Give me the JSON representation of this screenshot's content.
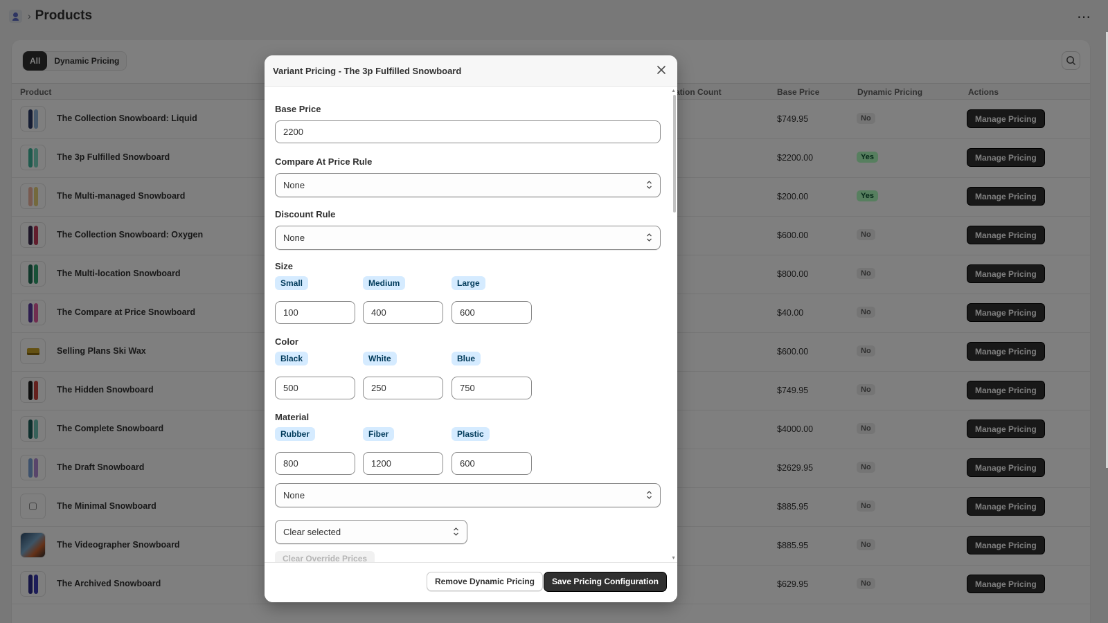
{
  "header": {
    "title": "Products",
    "more_label": "⋯"
  },
  "tabs": [
    {
      "label": "All"
    },
    {
      "label": "Dynamic Pricing"
    }
  ],
  "columns": {
    "product": "Product",
    "count": "ation Count",
    "base_price": "Base Price",
    "dynamic": "Dynamic Pricing",
    "actions": "Actions"
  },
  "rows": [
    {
      "name": "The Collection Snowboard: Liquid",
      "price": "$749.95",
      "dynamic": "No",
      "action": "Manage Pricing"
    },
    {
      "name": "The 3p Fulfilled Snowboard",
      "price": "$2200.00",
      "dynamic": "Yes",
      "action": "Manage Pricing"
    },
    {
      "name": "The Multi-managed Snowboard",
      "price": "$200.00",
      "dynamic": "Yes",
      "action": "Manage Pricing"
    },
    {
      "name": "The Collection Snowboard: Oxygen",
      "price": "$600.00",
      "dynamic": "No",
      "action": "Manage Pricing"
    },
    {
      "name": "The Multi-location Snowboard",
      "price": "$800.00",
      "dynamic": "No",
      "action": "Manage Pricing"
    },
    {
      "name": "The Compare at Price Snowboard",
      "price": "$40.00",
      "dynamic": "No",
      "action": "Manage Pricing"
    },
    {
      "name": "Selling Plans Ski Wax",
      "price": "$600.00",
      "dynamic": "No",
      "action": "Manage Pricing"
    },
    {
      "name": "The Hidden Snowboard",
      "price": "$749.95",
      "dynamic": "No",
      "action": "Manage Pricing"
    },
    {
      "name": "The Complete Snowboard",
      "price": "$4000.00",
      "dynamic": "No",
      "action": "Manage Pricing"
    },
    {
      "name": "The Draft Snowboard",
      "price": "$2629.95",
      "dynamic": "No",
      "action": "Manage Pricing"
    },
    {
      "name": "The Minimal Snowboard",
      "price": "$885.95",
      "dynamic": "No",
      "action": "Manage Pricing"
    },
    {
      "name": "The Videographer Snowboard",
      "price": "$885.95",
      "dynamic": "No",
      "action": "Manage Pricing"
    },
    {
      "name": "The Archived Snowboard",
      "price": "$629.95",
      "dynamic": "No",
      "action": "Manage Pricing"
    }
  ],
  "modal": {
    "title": "Variant Pricing - The 3p Fulfilled Snowboard",
    "base_price_label": "Base Price",
    "base_price_value": "2200",
    "compare_label": "Compare At Price Rule",
    "compare_value": "None",
    "discount_label": "Discount Rule",
    "discount_value": "None",
    "size": {
      "label": "Size",
      "options": [
        {
          "name": "Small",
          "value": "100"
        },
        {
          "name": "Medium",
          "value": "400"
        },
        {
          "name": "Large",
          "value": "600"
        }
      ]
    },
    "color": {
      "label": "Color",
      "options": [
        {
          "name": "Black",
          "value": "500"
        },
        {
          "name": "White",
          "value": "250"
        },
        {
          "name": "Blue",
          "value": "750"
        }
      ]
    },
    "material": {
      "label": "Material",
      "options": [
        {
          "name": "Rubber",
          "value": "800"
        },
        {
          "name": "Fiber",
          "value": "1200"
        },
        {
          "name": "Plastic",
          "value": "600"
        }
      ]
    },
    "extra_select_value": "None",
    "clear_select_value": "Clear selected",
    "clear_override_label": "Clear Override Prices",
    "remove_label": "Remove Dynamic Pricing",
    "save_label": "Save Pricing Configuration"
  }
}
